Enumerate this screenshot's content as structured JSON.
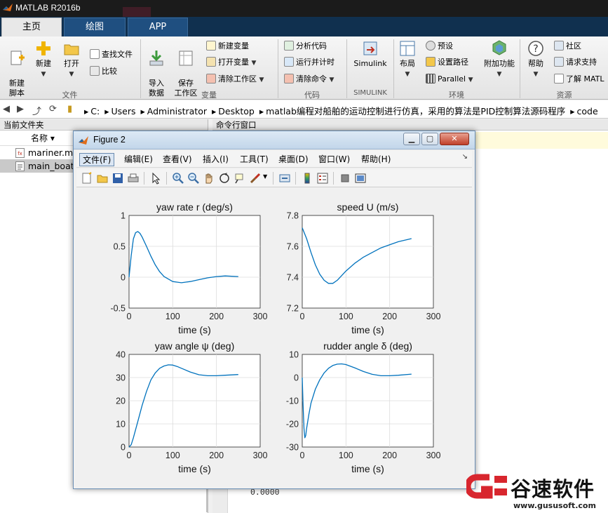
{
  "app": {
    "title": "MATLAB R2016b"
  },
  "tabs": [
    {
      "label": "主页"
    },
    {
      "label": "绘图"
    },
    {
      "label": "APP"
    }
  ],
  "ribbon": {
    "file": {
      "group_label": "文件",
      "new_script": "新建\n脚本",
      "new": "新建",
      "open": "打开",
      "find_files": "查找文件",
      "compare": "比较"
    },
    "variable": {
      "group_label": "变量",
      "import": "导入\n数据",
      "save_ws": "保存\n工作区",
      "new_var": "新建变量",
      "open_var": "打开变量",
      "clear_ws": "清除工作区"
    },
    "code": {
      "group_label": "代码",
      "analyze": "分析代码",
      "run_time": "运行并计时",
      "clear_cmd": "清除命令"
    },
    "simulink": {
      "group_label": "SIMULINK",
      "simulink": "Simulink"
    },
    "env": {
      "group_label": "环境",
      "layout": "布局",
      "prefs": "预设",
      "set_path": "设置路径",
      "parallel": "Parallel",
      "addons": "附加功能"
    },
    "resources": {
      "group_label": "资源",
      "help": "帮助",
      "community": "社区",
      "request_support": "请求支持",
      "learn": "了解 MATL"
    }
  },
  "address": {
    "segments": [
      "C:",
      "Users",
      "Administrator",
      "Desktop",
      "matlab编程对船舶的运动控制进行仿真，采用的算法是PID控制算法源码程序",
      "code"
    ]
  },
  "current_folder": {
    "title": "当前文件夹",
    "col_name": "名称 ▾",
    "files": [
      {
        "name": "mariner.m"
      },
      {
        "name": "main_boat"
      }
    ]
  },
  "command_window": {
    "title": "命令行窗口",
    "output": "0.0000"
  },
  "figure": {
    "title": "Figure 2",
    "menus": [
      "文件(F)",
      "编辑(E)",
      "查看(V)",
      "插入(I)",
      "工具(T)",
      "桌面(D)",
      "窗口(W)",
      "帮助(H)"
    ]
  },
  "watermark": {
    "text": "谷速软件",
    "url": "www.gususoft.com",
    "color": "#d8262e"
  },
  "colors": {
    "line": "#0072bd",
    "tab_active": "#e8e8e8",
    "tab_bar": "#10304f"
  },
  "chart_data": [
    {
      "type": "line",
      "title": "yaw rate r (deg/s)",
      "xlabel": "time (s)",
      "xlim": [
        0,
        300
      ],
      "ylim": [
        -0.5,
        1
      ],
      "xticks": [
        0,
        100,
        200,
        300
      ],
      "yticks": [
        -0.5,
        0,
        0.5,
        1
      ],
      "grid": true,
      "x": [
        0,
        5,
        10,
        15,
        20,
        25,
        30,
        40,
        50,
        60,
        70,
        80,
        100,
        120,
        130,
        140,
        160,
        180,
        200,
        220,
        250
      ],
      "y": [
        0,
        0.35,
        0.62,
        0.72,
        0.74,
        0.71,
        0.65,
        0.5,
        0.34,
        0.2,
        0.09,
        0.01,
        -0.07,
        -0.09,
        -0.08,
        -0.07,
        -0.04,
        -0.01,
        0.01,
        0.02,
        0.01
      ]
    },
    {
      "type": "line",
      "title": "speed U (m/s)",
      "xlabel": "time (s)",
      "xlim": [
        0,
        300
      ],
      "ylim": [
        7.2,
        7.8
      ],
      "xticks": [
        0,
        100,
        200,
        300
      ],
      "yticks": [
        7.2,
        7.4,
        7.6,
        7.8
      ],
      "grid": true,
      "x": [
        0,
        10,
        20,
        30,
        40,
        50,
        60,
        70,
        80,
        90,
        100,
        120,
        140,
        160,
        180,
        200,
        220,
        250
      ],
      "y": [
        7.72,
        7.65,
        7.56,
        7.48,
        7.42,
        7.38,
        7.36,
        7.36,
        7.38,
        7.41,
        7.44,
        7.49,
        7.53,
        7.56,
        7.59,
        7.61,
        7.63,
        7.65
      ]
    },
    {
      "type": "line",
      "title": "yaw angle ψ (deg)",
      "xlabel": "time (s)",
      "xlim": [
        0,
        300
      ],
      "ylim": [
        0,
        40
      ],
      "xticks": [
        0,
        100,
        200,
        300
      ],
      "yticks": [
        0,
        10,
        20,
        30,
        40
      ],
      "grid": true,
      "x": [
        0,
        5,
        10,
        20,
        30,
        40,
        50,
        60,
        70,
        80,
        90,
        100,
        110,
        120,
        140,
        160,
        180,
        200,
        220,
        250
      ],
      "y": [
        0,
        1,
        4,
        11,
        18,
        24,
        29,
        32,
        34,
        35,
        35.5,
        35.4,
        34.8,
        34,
        32.4,
        31.2,
        30.8,
        30.8,
        31,
        31.3
      ]
    },
    {
      "type": "line",
      "title": "rudder angle δ (deg)",
      "xlabel": "time (s)",
      "xlim": [
        0,
        300
      ],
      "ylim": [
        -30,
        10
      ],
      "xticks": [
        0,
        100,
        200,
        300
      ],
      "yticks": [
        -30,
        -20,
        -10,
        0,
        10
      ],
      "grid": true,
      "x": [
        0,
        2,
        4,
        6,
        8,
        10,
        15,
        20,
        30,
        40,
        50,
        60,
        70,
        80,
        90,
        100,
        120,
        140,
        160,
        180,
        200,
        220,
        250
      ],
      "y": [
        0,
        -12,
        -22,
        -26,
        -25,
        -22,
        -16,
        -11,
        -5,
        -1,
        2,
        4,
        5.2,
        5.8,
        5.9,
        5.6,
        4.2,
        2.6,
        1.4,
        0.8,
        0.8,
        1,
        1.5
      ]
    }
  ]
}
